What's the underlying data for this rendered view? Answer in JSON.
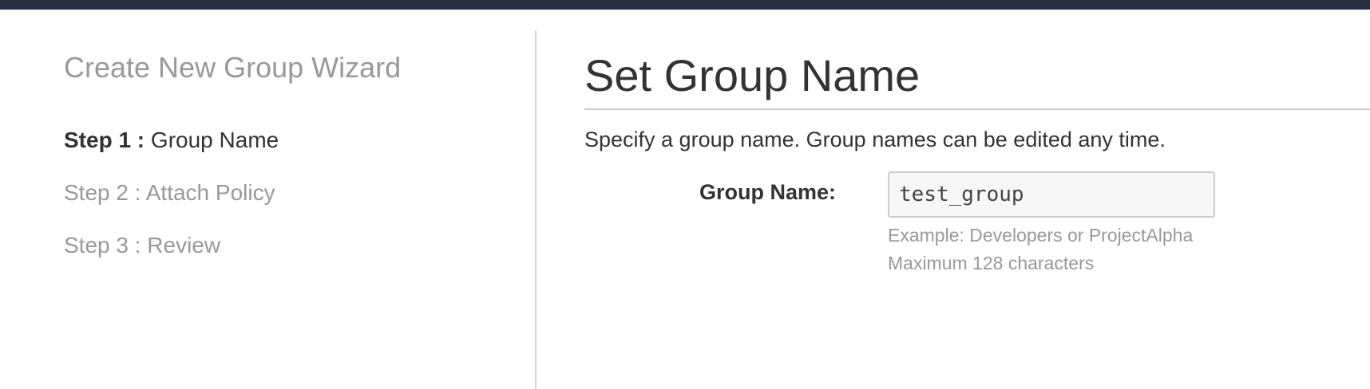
{
  "wizard": {
    "title": "Create New Group Wizard",
    "steps": [
      {
        "prefix": "Step 1 :",
        "label": "Group Name",
        "state": "active"
      },
      {
        "prefix": "Step 2 :",
        "label": "Attach Policy",
        "state": "inactive"
      },
      {
        "prefix": "Step 3 :",
        "label": "Review",
        "state": "inactive"
      }
    ]
  },
  "main": {
    "title": "Set Group Name",
    "description": "Specify a group name. Group names can be edited any time.",
    "group_name_field": {
      "label": "Group Name:",
      "value": "test_group",
      "hint_example": "Example: Developers or ProjectAlpha",
      "hint_max": "Maximum 128 characters"
    }
  },
  "colors": {
    "topbar": "#232f3e",
    "active_text": "#333333",
    "muted_text": "#999999"
  }
}
